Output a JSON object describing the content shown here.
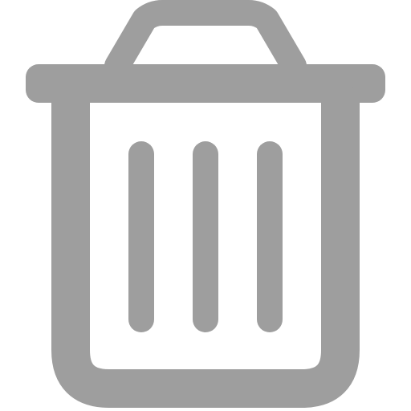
{
  "icon": {
    "name": "trash-icon",
    "color": "#9e9e9e",
    "background": "#ffffff"
  }
}
